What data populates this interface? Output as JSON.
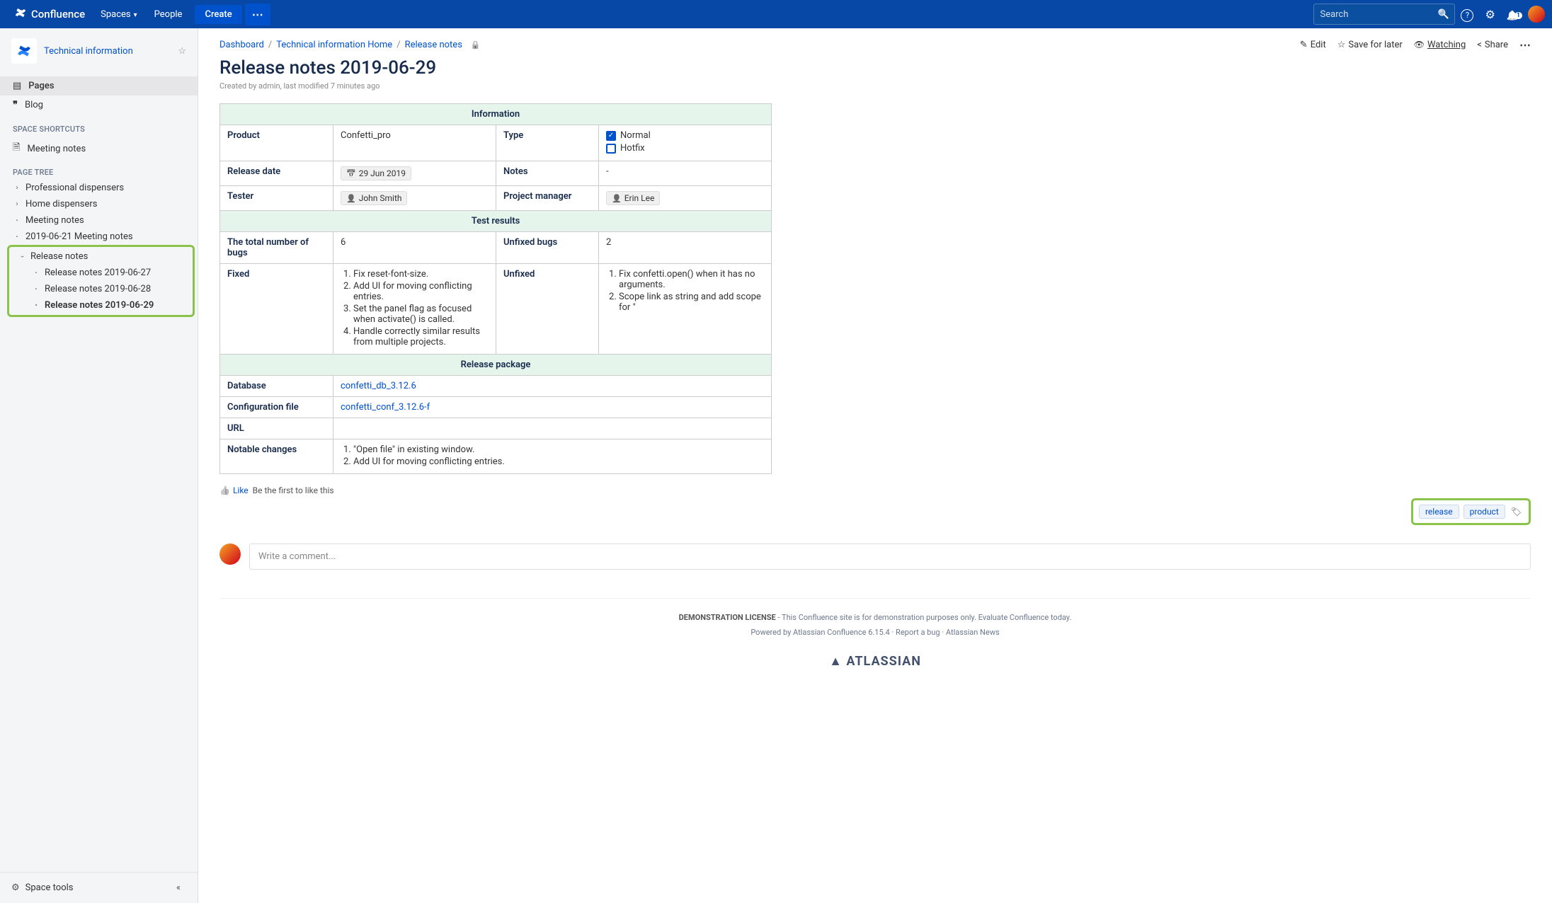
{
  "header": {
    "brand": "Confluence",
    "nav": {
      "spaces": "Spaces",
      "people": "People"
    },
    "create": "Create",
    "search_placeholder": "Search",
    "notif_count": "1"
  },
  "sidebar": {
    "space_name": "Technical information",
    "pages": "Pages",
    "blog": "Blog",
    "shortcuts_heading": "SPACE SHORTCUTS",
    "meeting_notes": "Meeting notes",
    "tree_heading": "PAGE TREE",
    "tree": {
      "pro_dispensers": "Professional dispensers",
      "home_dispensers": "Home dispensers",
      "meeting_notes": "Meeting notes",
      "dated_meeting": "2019-06-21 Meeting notes",
      "release_notes": "Release notes",
      "rn1": "Release notes 2019-06-27",
      "rn2": "Release notes 2019-06-28",
      "rn3": "Release notes 2019-06-29"
    },
    "footer": {
      "tools": "Space tools"
    }
  },
  "breadcrumb": {
    "dashboard": "Dashboard",
    "home": "Technical information Home",
    "release": "Release notes"
  },
  "actions": {
    "edit": "Edit",
    "save": "Save for later",
    "watching": "Watching",
    "share": "Share"
  },
  "page": {
    "title": "Release notes 2019-06-29",
    "meta": "Created by admin, last modified 7 minutes ago"
  },
  "table": {
    "sec_info": "Information",
    "product_label": "Product",
    "product_value": "Confetti_pro",
    "type_label": "Type",
    "type_normal": "Normal",
    "type_hotfix": "Hotfix",
    "release_date_label": "Release date",
    "release_date_value": "29 Jun 2019",
    "notes_label": "Notes",
    "notes_value": "-",
    "tester_label": "Tester",
    "tester_value": "John Smith",
    "pm_label": "Project manager",
    "pm_value": "Erin Lee",
    "sec_tests": "Test results",
    "total_bugs_label": "The total number of bugs",
    "total_bugs_value": "6",
    "unfixed_bugs_label": "Unfixed bugs",
    "unfixed_bugs_value": "2",
    "fixed_label": "Fixed",
    "fixed_items": {
      "i1": "Fix reset-font-size.",
      "i2": "Add UI for moving conflicting entries.",
      "i3": "Set the panel flag as focused when activate() is called.",
      "i4": "Handle correctly similar results from multiple projects."
    },
    "unfixed_label": "Unfixed",
    "unfixed_items": {
      "i1": "Fix confetti.open() when it has no arguments.",
      "i2": "Scope link as string and add scope for \""
    },
    "sec_package": "Release package",
    "db_label": "Database",
    "db_value": "confetti_db_3.12.6",
    "conf_label": "Configuration file",
    "conf_value": "confetti_conf_3.12.6-f",
    "url_label": "URL",
    "changes_label": "Notable changes",
    "changes": {
      "i1": "\"Open file\" in existing window.",
      "i2": "Add UI for moving conflicting entries."
    }
  },
  "like": {
    "like": "Like",
    "first": "Be the first to like this"
  },
  "labels": {
    "l1": "release",
    "l2": "product"
  },
  "comment": {
    "placeholder": "Write a comment..."
  },
  "footer": {
    "demo_a": "DEMONSTRATION LICENSE",
    "demo_b": " - This Confluence site is for demonstration purposes only. Evaluate Confluence today.",
    "row2": "Powered by Atlassian Confluence 6.15.4   ·   Report a bug   ·   Atlassian News",
    "atl": "▲ ATLASSIAN"
  }
}
